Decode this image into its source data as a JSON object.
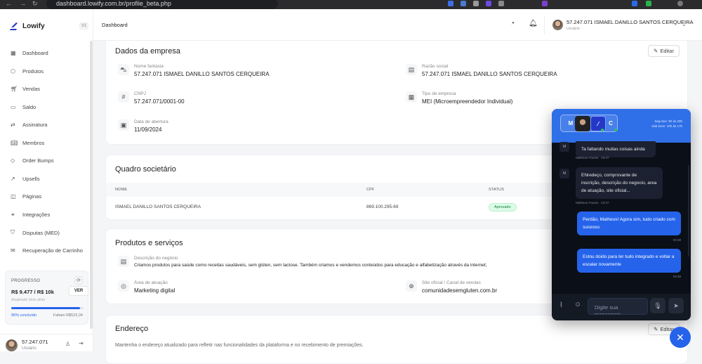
{
  "browser": {
    "url": "dashboard.lowify.com.br/profile_beta.php"
  },
  "sidebar": {
    "brand": "Lowify",
    "version": "V1",
    "items": [
      {
        "label": "Dashboard",
        "icon": "grid-icon"
      },
      {
        "label": "Produtos",
        "icon": "box-icon"
      },
      {
        "label": "Vendas",
        "icon": "cart-icon"
      },
      {
        "label": "Saldo",
        "icon": "wallet-icon"
      },
      {
        "label": "Assinatura",
        "icon": "repeat-icon"
      },
      {
        "label": "Membros",
        "icon": "book-icon"
      },
      {
        "label": "Order Bumps",
        "icon": "tag-icon"
      },
      {
        "label": "Upsells",
        "icon": "trending-up-icon"
      },
      {
        "label": "Páginas",
        "icon": "layers-icon"
      },
      {
        "label": "Integrações",
        "icon": "link-icon"
      },
      {
        "label": "Disputas (MED)",
        "icon": "shield-icon"
      },
      {
        "label": "Recuperação de Carrinho",
        "icon": "message-icon"
      }
    ],
    "progress": {
      "label": "PROGRESSO",
      "amount": "R$ 9.477 / R$ 10k",
      "button": "VER",
      "updated": "Atualizado 3min atrás",
      "percent": 95,
      "percent_label": "95% concluído",
      "remaining": "Faltam R$523,34"
    },
    "user": {
      "name": "57.247.071",
      "role": "Usuário"
    }
  },
  "header": {
    "breadcrumb": "Dashboard",
    "user_name": "57.247.071 ISMAEL DANILLO SANTOS CERQUEIRA",
    "user_role": "Usuário"
  },
  "company": {
    "title": "Dados da empresa",
    "edit": "Editar",
    "fields": [
      {
        "label": "Nome fantasia",
        "value": "57.247.071 ISMAEL DANILLO SANTOS CERQUEIRA"
      },
      {
        "label": "Razão social",
        "value": "57.247.071 ISMAEL DANILLO SANTOS CERQUEIRA"
      },
      {
        "label": "CNPJ",
        "value": "57.247.071/0001-00"
      },
      {
        "label": "Tipo de empresa",
        "value": "MEI (Microempreendedor Individual)"
      },
      {
        "label": "Data de abertura",
        "value": "11/09/2024"
      }
    ]
  },
  "partners": {
    "title": "Quadro societário",
    "columns": [
      "NOME",
      "CPF",
      "STATUS"
    ],
    "rows": [
      {
        "name": "ISMAEL DANILLO SANTOS CERQUEIRA",
        "cpf": "869.100.295-69",
        "status": "Aprovado"
      }
    ]
  },
  "products": {
    "title": "Produtos e serviços",
    "fields": [
      {
        "label": "Descrição do negócio",
        "value": "Criamos produtos para saúde como receitas saudáveis, sem glúten, sem lactose. Também criamos e vendemos conteúdos para educação e alfabetização através da internet;"
      },
      {
        "label": "Área de atuação",
        "value": "Marketing digital"
      },
      {
        "label": "Site oficial / Canal de vendas",
        "value": "comunidadesemgluten.com.br"
      }
    ]
  },
  "address": {
    "title": "Endereço",
    "edit": "Editar",
    "description": "Mantenha o endereço atualizado para refletir nas funcionalidades da plataforma e no recebimento de premiações."
  },
  "chat": {
    "agents": [
      "M",
      "C"
    ],
    "hours": [
      "Seg-Sex: 9h às 20h",
      "Sáb-Dom: 10h às 17h"
    ],
    "messages": [
      {
        "from": "M",
        "text": "Ta faltando muitas coisas ainda",
        "meta": "Matheus Fausto · 23:37"
      },
      {
        "from": "M",
        "text": "ENredeço, comprovante de inscrição, descrição do negocio, area de atuação, site oficial...",
        "meta": "Matheus Fausto · 23:37"
      },
      {
        "from": "me",
        "text": "Perdão, Matheus! Agora sim, tudo criado com sucesso.",
        "meta": "03:38"
      },
      {
        "from": "me",
        "text": "Estou doido para ter tudo integrado e voltar a escalar novamente",
        "meta": "03:38"
      }
    ],
    "placeholder": "Digite sua mensagem..."
  },
  "colors": {
    "accent": "#2563eb",
    "chat_header": "#2f6fe8",
    "chat_bg": "#0b0f17",
    "approved": "#16803c"
  }
}
